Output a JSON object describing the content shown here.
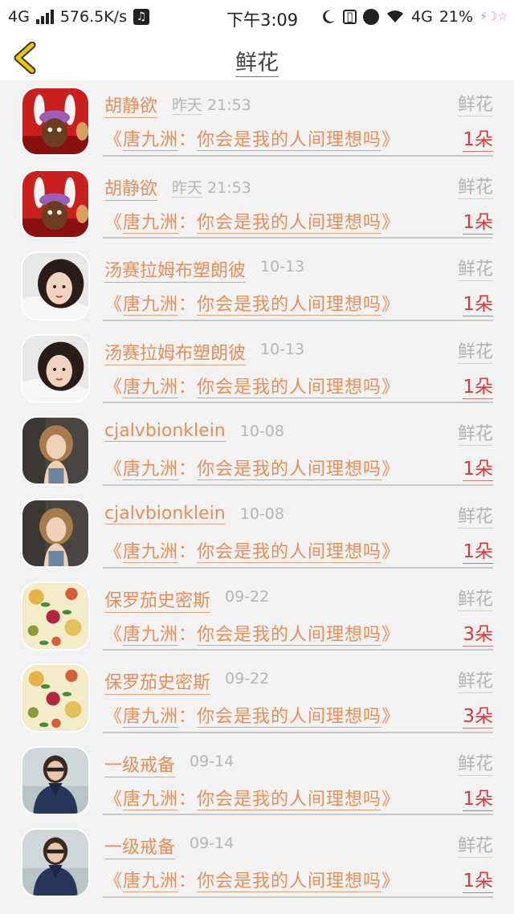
{
  "status_bar": {
    "network": "4G",
    "speed": "576.5K/s",
    "time": "下午3:09",
    "network2": "4G",
    "battery": "21%"
  },
  "header": {
    "title": "鲜花"
  },
  "gifts": [
    {
      "sender": "胡静欲",
      "day": "昨天",
      "time": "21:53",
      "type": "鲜花",
      "song": "《唐九洲：你会是我的人间理想吗》",
      "count": "1朵",
      "avatar": "cartoon"
    },
    {
      "sender": "胡静欲",
      "day": "昨天",
      "time": "21:53",
      "type": "鲜花",
      "song": "《唐九洲：你会是我的人间理想吗》",
      "count": "1朵",
      "avatar": "cartoon"
    },
    {
      "sender": "汤赛拉姆布塑朗彼",
      "day": "",
      "time": "10-13",
      "type": "鲜花",
      "song": "《唐九洲：你会是我的人间理想吗》",
      "count": "1朵",
      "avatar": "girl"
    },
    {
      "sender": "汤赛拉姆布塑朗彼",
      "day": "",
      "time": "10-13",
      "type": "鲜花",
      "song": "《唐九洲：你会是我的人间理想吗》",
      "count": "1朵",
      "avatar": "girl"
    },
    {
      "sender": "cjalvbionklein",
      "day": "",
      "time": "10-08",
      "type": "鲜花",
      "song": "《唐九洲：你会是我的人间理想吗》",
      "count": "1朵",
      "avatar": "blonde"
    },
    {
      "sender": "cjalvbionklein",
      "day": "",
      "time": "10-08",
      "type": "鲜花",
      "song": "《唐九洲：你会是我的人间理想吗》",
      "count": "1朵",
      "avatar": "blonde"
    },
    {
      "sender": "保罗茄史密斯",
      "day": "",
      "time": "09-22",
      "type": "鲜花",
      "song": "《唐九洲：你会是我的人间理想吗》",
      "count": "3朵",
      "avatar": "fruit"
    },
    {
      "sender": "保罗茄史密斯",
      "day": "",
      "time": "09-22",
      "type": "鲜花",
      "song": "《唐九洲：你会是我的人间理想吗》",
      "count": "3朵",
      "avatar": "fruit"
    },
    {
      "sender": "一级戒备",
      "day": "",
      "time": "09-14",
      "type": "鲜花",
      "song": "《唐九洲：你会是我的人间理想吗》",
      "count": "1朵",
      "avatar": "scarf"
    },
    {
      "sender": "一级戒备",
      "day": "",
      "time": "09-14",
      "type": "鲜花",
      "song": "《唐九洲：你会是我的人间理想吗》",
      "count": "1朵",
      "avatar": "scarf"
    }
  ],
  "colors": {
    "accent": "#e68f58",
    "count": "#d83a3a",
    "muted": "#b7b7b7",
    "back_icon": "#f2c300"
  },
  "icons": {
    "back": "chevron-left-icon"
  }
}
